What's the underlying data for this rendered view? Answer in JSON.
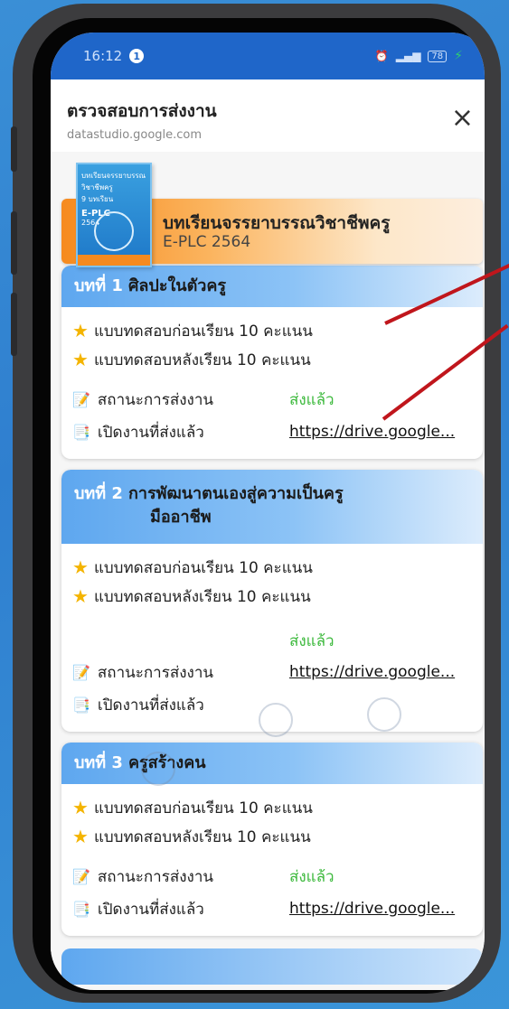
{
  "status": {
    "time": "16:12",
    "notif": "1",
    "battery": "78"
  },
  "header": {
    "title": "ตรวจสอบการส่งงาน",
    "url": "datastudio.google.com",
    "close_icon": "×"
  },
  "course": {
    "book_top": "บทเรียนจรรยาบรรณวิชาชีพครู",
    "book_sub": "9 บทเรียน",
    "book_code": "E-PLC",
    "book_year": "2564",
    "title": "บทเรียนจรรยาบรรณวิชาชีพครู",
    "subtitle": "E-PLC 2564"
  },
  "labels": {
    "pretest": "แบบทดสอบก่อนเรียน 10 คะแนน",
    "posttest": "แบบทดสอบหลังเรียน 10 คะแนน",
    "status": "สถานะการส่งงาน",
    "open": "เปิดงานที่ส่งแล้ว"
  },
  "lessons": [
    {
      "num": "บทที่ 1",
      "name": "ศิลปะในตัวครู",
      "status": "ส่งแล้ว",
      "link": "https://drive.google..."
    },
    {
      "num": "บทที่ 2",
      "name": "การพัฒนาตนเองสู่ความเป็นครู",
      "name2": "มืออาชีพ",
      "status": "ส่งแล้ว",
      "link": "https://drive.google..."
    },
    {
      "num": "บทที่ 3",
      "name": "ครูสร้างคน",
      "status": "ส่งแล้ว",
      "link": "https://drive.google..."
    }
  ]
}
